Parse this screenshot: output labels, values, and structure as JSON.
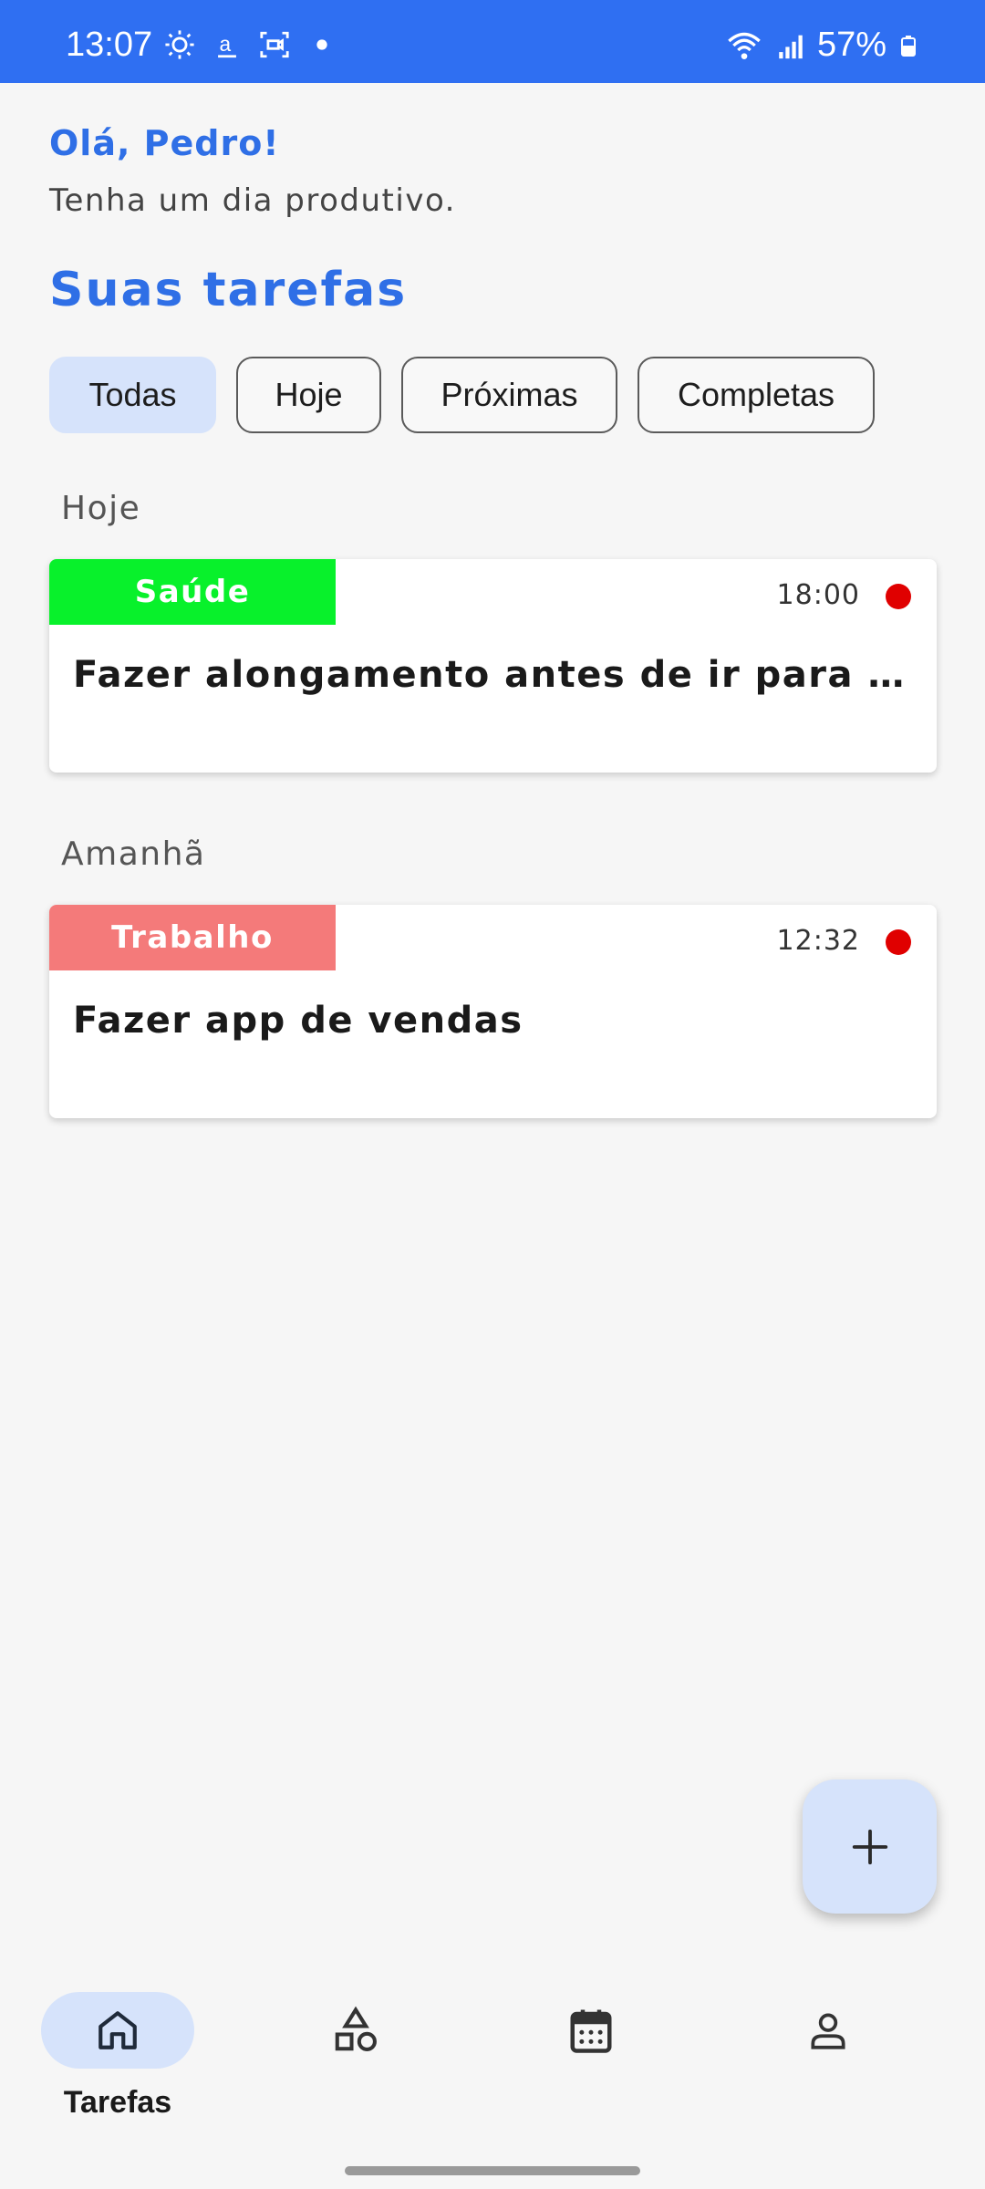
{
  "status_bar": {
    "time": "13:07",
    "battery": "57%",
    "left_icons": [
      "brightness-icon",
      "amazon-icon",
      "screen-record-icon",
      "notification-dot-icon"
    ],
    "right_icons": [
      "wifi-icon",
      "signal-icon",
      "battery-icon"
    ]
  },
  "header": {
    "greeting": "Olá, Pedro!",
    "subtitle": "Tenha um dia produtivo.",
    "section_title": "Suas tarefas"
  },
  "filters": [
    {
      "label": "Todas",
      "active": true
    },
    {
      "label": "Hoje",
      "active": false
    },
    {
      "label": "Próximas",
      "active": false
    },
    {
      "label": "Completas",
      "active": false
    }
  ],
  "groups": [
    {
      "label": "Hoje",
      "tasks": [
        {
          "tag": "Saúde",
          "tag_color": "#08f12b",
          "time": "18:00",
          "title": "Fazer alongamento antes de ir para faculdade",
          "priority_color": "#e00000"
        }
      ]
    },
    {
      "label": "Amanhã",
      "tasks": [
        {
          "tag": "Trabalho",
          "tag_color": "#f47a7a",
          "time": "12:32",
          "title": "Fazer app de vendas",
          "priority_color": "#e00000"
        }
      ]
    }
  ],
  "fab": {
    "icon": "plus-icon"
  },
  "bottom_nav": [
    {
      "icon": "home-icon",
      "label": "Tarefas",
      "active": true
    },
    {
      "icon": "shapes-icon",
      "label": "",
      "active": false
    },
    {
      "icon": "calendar-icon",
      "label": "",
      "active": false
    },
    {
      "icon": "profile-icon",
      "label": "",
      "active": false
    }
  ],
  "colors": {
    "accent": "#2f6fe6",
    "status_bar": "#2f6ff2",
    "chip_active": "#d6e3fb",
    "priority": "#e00000"
  }
}
